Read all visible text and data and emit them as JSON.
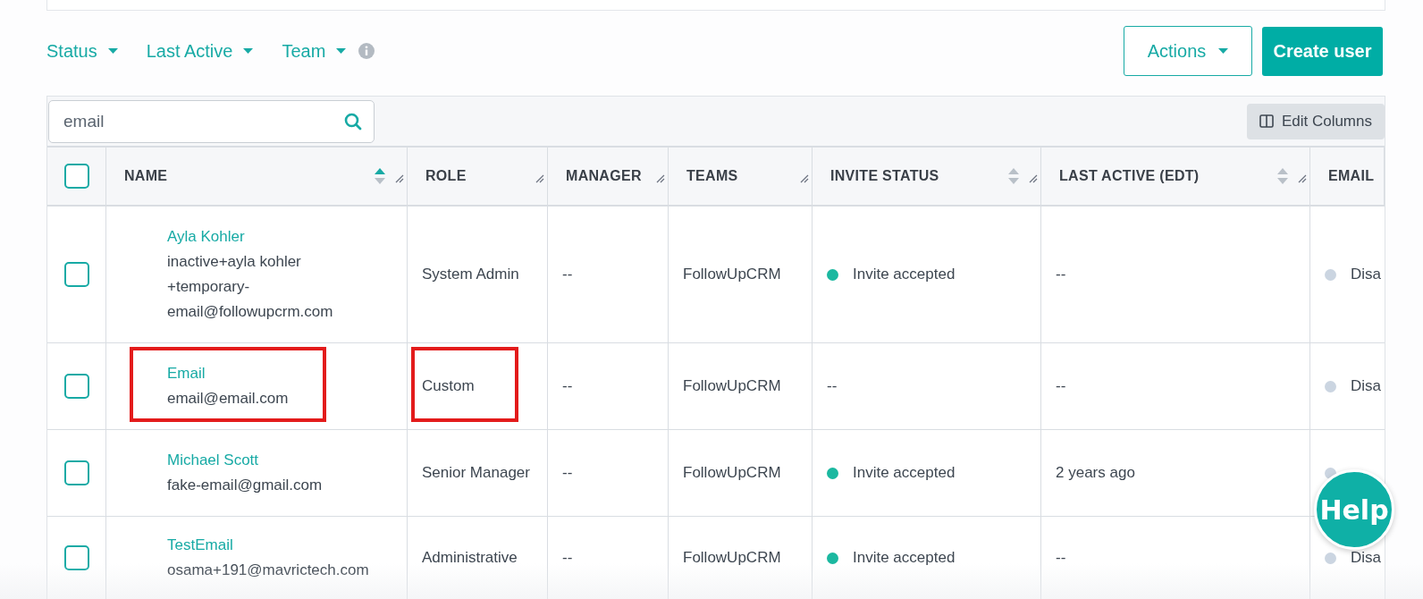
{
  "filters": [
    {
      "label": "Status"
    },
    {
      "label": "Last Active"
    },
    {
      "label": "Team"
    }
  ],
  "actions": {
    "menu": "Actions",
    "primary": "Create user"
  },
  "search": {
    "value": "email"
  },
  "edit_columns": "Edit Columns",
  "table": {
    "select_all_checked": false,
    "columns": [
      {
        "label": "NAME",
        "sortable": true,
        "sorted": true
      },
      {
        "label": "ROLE",
        "sortable": false
      },
      {
        "label": "MANAGER",
        "sortable": false
      },
      {
        "label": "TEAMS",
        "sortable": false
      },
      {
        "label": "INVITE STATUS",
        "sortable": true,
        "sorted": false
      },
      {
        "label": "LAST ACTIVE (EDT)",
        "sortable": true,
        "sorted": false
      },
      {
        "label": "EMAIL",
        "sortable": false
      }
    ],
    "rows": [
      {
        "checked": false,
        "name": "Ayla Kohler",
        "email": "inactive+ayla kohler +temporary-email@followupcrm.com",
        "role": "System Admin",
        "manager": "--",
        "teams": "FollowUpCRM",
        "invite_status": {
          "text": "Invite accepted",
          "color": "#1bb8a0"
        },
        "last_active": "--",
        "email_status": {
          "text": "Disa",
          "color": "#cbd5e1"
        },
        "highlighted": false
      },
      {
        "checked": false,
        "name": "Email",
        "email": "email@email.com",
        "role": "Custom",
        "manager": "--",
        "teams": "FollowUpCRM",
        "invite_status": {
          "text": "--"
        },
        "last_active": "--",
        "email_status": {
          "text": "Disa",
          "color": "#cbd5e1"
        },
        "highlighted": true
      },
      {
        "checked": false,
        "name": "Michael Scott",
        "email": "fake-email@gmail.com",
        "role": "Senior Manager",
        "manager": "--",
        "teams": "FollowUpCRM",
        "invite_status": {
          "text": "Invite accepted",
          "color": "#1bb8a0"
        },
        "last_active": "2 years ago",
        "email_status": {
          "color": "#cbd5e1"
        },
        "highlighted": false
      },
      {
        "checked": false,
        "name": "TestEmail",
        "email": "osama+191@mavrictech.com",
        "role": "Administrative",
        "manager": "--",
        "teams": "FollowUpCRM",
        "invite_status": {
          "text": "Invite accepted",
          "color": "#1bb8a0"
        },
        "last_active": "--",
        "email_status": {
          "text": "Disa",
          "color": "#cbd5e1"
        },
        "highlighted": false
      }
    ]
  },
  "help": "Help"
}
